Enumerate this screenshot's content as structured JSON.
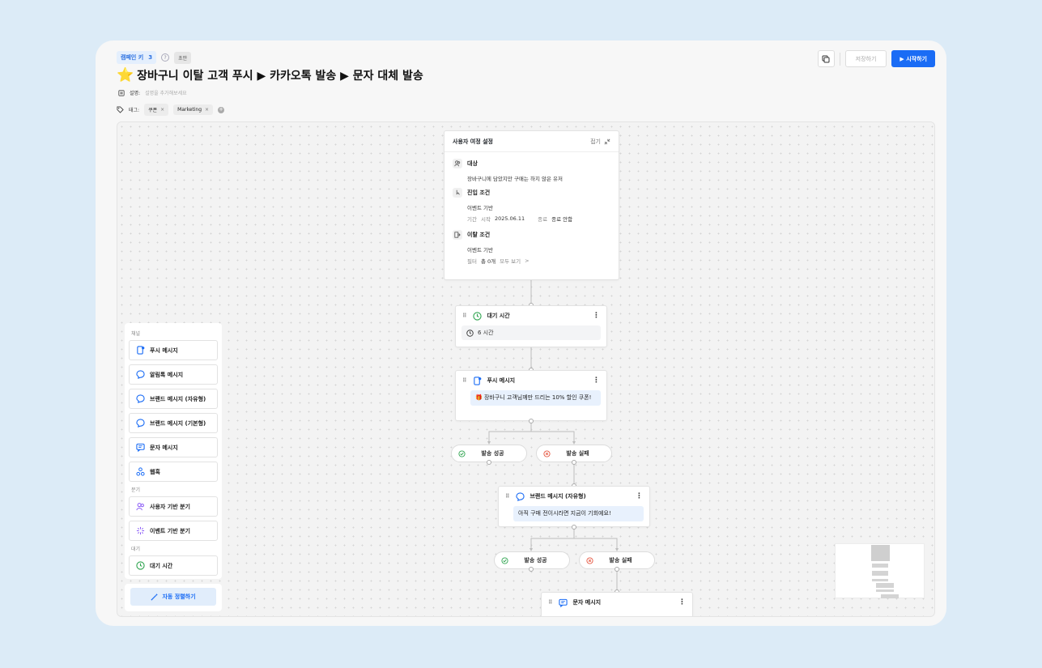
{
  "header": {
    "campaign_badge": "캠페인 키",
    "campaign_count": "3",
    "help_icon_text": "?",
    "status": "초안",
    "star_icon": "⭐",
    "title": "장바구니 이탈 고객 푸시 ▶ 카카오톡 발송 ▶ 문자 대체 발송",
    "desc_label": "설명:",
    "desc_placeholder": "설명을 추가해보세요",
    "tags_label": "태그:",
    "tags": [
      "쿠폰",
      "Marketing"
    ],
    "tag_remove": "×",
    "tag_add": "+",
    "save_label": "저장하기",
    "start_label": "▶ 시작하기"
  },
  "journey": {
    "title": "사용자 여정 설정",
    "fold_label": "접기",
    "target_label": "대상",
    "target_value": "장바구니에 담았지만 구매는 하지 않은 유저",
    "entry_label": "진입 조건",
    "entry_type": "이벤트 기반",
    "period_label": "기간",
    "start_label": "시작",
    "start_date": "2025.06.11",
    "end_label": "종료",
    "end_value": "종료 안함",
    "exit_label": "이탈 조건",
    "exit_type": "이벤트 기반",
    "filter_label": "필터",
    "filter_count": "총 0개",
    "view_all": "모두 보기",
    "chevron": ">"
  },
  "nodes": {
    "wait_title": "대기 시간",
    "wait_value": "6 시간",
    "push_title": "푸시 메시지",
    "push_body": "🎁 장바구니 고객님께만 드리는 10% 할인 쿠폰!",
    "brand_title": "브랜드 메시지 (자유형)",
    "brand_body": "아직 구매 전이시라면 지금이 기회예요!",
    "sms_title": "문자 메시지",
    "success_label": "발송 성공",
    "fail_label": "발송 실패",
    "grip": "⠿",
    "kebab": "⋮"
  },
  "palette": {
    "section_channel": "채널",
    "section_branch": "분기",
    "section_wait": "대기",
    "items_channel": [
      "푸시 메시지",
      "알림톡 메시지",
      "브랜드 메시지 (자유형)",
      "브랜드 메시지 (기본형)",
      "문자 메시지",
      "웹훅"
    ],
    "items_branch": [
      "사용자 기반 분기",
      "이벤트 기반 분기"
    ],
    "items_wait": [
      "대기 시간"
    ],
    "auto_arrange": "자동 정렬하기"
  },
  "colors": {
    "accent": "#1a6cf5",
    "success": "#2ea44f",
    "fail": "#e5533d",
    "branch": "#8b5cf6"
  }
}
